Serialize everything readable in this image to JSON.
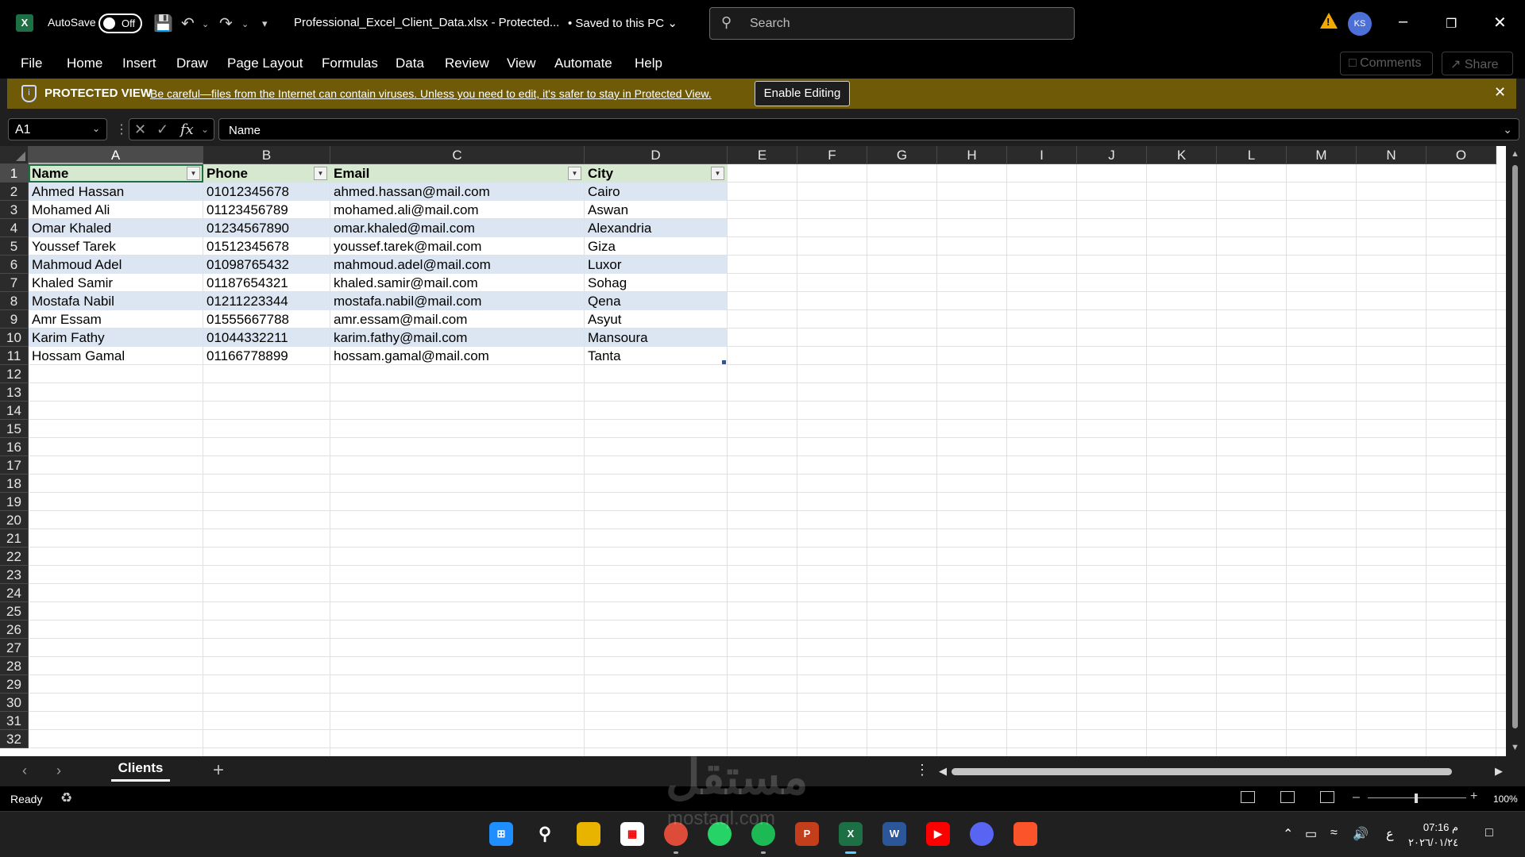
{
  "titlebar": {
    "app_icon": "excel-icon",
    "autosave_label": "AutoSave",
    "autosave_state": "Off",
    "file_title": "Professional_Excel_Client_Data.xlsx  -  Protected...",
    "save_status": "• Saved to this PC",
    "search_placeholder": "Search",
    "user_initials": "KS",
    "warning_icon": "warning-icon"
  },
  "menu": {
    "items": [
      "File",
      "Home",
      "Insert",
      "Draw",
      "Page Layout",
      "Formulas",
      "Data",
      "Review",
      "View",
      "Automate",
      "Help"
    ],
    "comments_label": "Comments",
    "share_label": "Share"
  },
  "protected_view": {
    "label": "PROTECTED VIEW",
    "message": "Be careful—files from the Internet can contain viruses. Unless you need to edit, it's safer to stay in Protected View.",
    "button": "Enable Editing",
    "background": "#6f5b07"
  },
  "formula_bar": {
    "name_box": "A1",
    "fx": "fx",
    "formula": "Name"
  },
  "sheet": {
    "columns": [
      "A",
      "B",
      "C",
      "D",
      "E",
      "F",
      "G",
      "H",
      "I",
      "J",
      "K",
      "L",
      "M",
      "N",
      "O"
    ],
    "rows": [
      "1",
      "2",
      "3",
      "4",
      "5",
      "6",
      "7",
      "8",
      "9",
      "10",
      "11",
      "12",
      "13",
      "14",
      "15",
      "16",
      "17",
      "18",
      "19",
      "20",
      "21",
      "22",
      "23",
      "24",
      "25",
      "26",
      "27",
      "28",
      "29",
      "30",
      "31",
      "32"
    ],
    "table_headers": [
      "Name",
      "Phone",
      "Email",
      "City"
    ],
    "table_rows": [
      [
        "Ahmed Hassan",
        "01012345678",
        "ahmed.hassan@mail.com",
        "Cairo"
      ],
      [
        "Mohamed Ali",
        "01123456789",
        "mohamed.ali@mail.com",
        "Aswan"
      ],
      [
        "Omar Khaled",
        "01234567890",
        "omar.khaled@mail.com",
        "Alexandria"
      ],
      [
        "Youssef Tarek",
        "01512345678",
        "youssef.tarek@mail.com",
        "Giza"
      ],
      [
        "Mahmoud Adel",
        "01098765432",
        "mahmoud.adel@mail.com",
        "Luxor"
      ],
      [
        "Khaled Samir",
        "01187654321",
        "khaled.samir@mail.com",
        "Sohag"
      ],
      [
        "Mostafa Nabil",
        "01211223344",
        "mostafa.nabil@mail.com",
        "Qena"
      ],
      [
        "Amr Essam",
        "01555667788",
        "amr.essam@mail.com",
        "Asyut"
      ],
      [
        "Karim Fathy",
        "01044332211",
        "karim.fathy@mail.com",
        "Mansoura"
      ],
      [
        "Hossam Gamal",
        "01166778899",
        "hossam.gamal@mail.com",
        "Tanta"
      ]
    ],
    "header_fill": "#d6e8cf",
    "band_fill": "#dce6f2"
  },
  "sheet_tabs": {
    "active": "Clients",
    "add_label": "+"
  },
  "status": {
    "ready": "Ready",
    "zoom": "100%"
  },
  "taskbar": {
    "apps": [
      "windows-start-icon",
      "search-icon",
      "file-explorer-icon",
      "microsoft-store-icon",
      "chrome-icon",
      "whatsapp-icon",
      "spotify-icon",
      "powerpoint-icon",
      "excel-icon",
      "word-icon",
      "youtube-icon",
      "discord-icon",
      "brave-icon"
    ],
    "keyboard_lang": "ع",
    "time": "07:16 م",
    "date": "٢٠٢٦/٠١/٢٤"
  },
  "watermark": {
    "text": "مستقل",
    "sub": "mostaql.com"
  }
}
